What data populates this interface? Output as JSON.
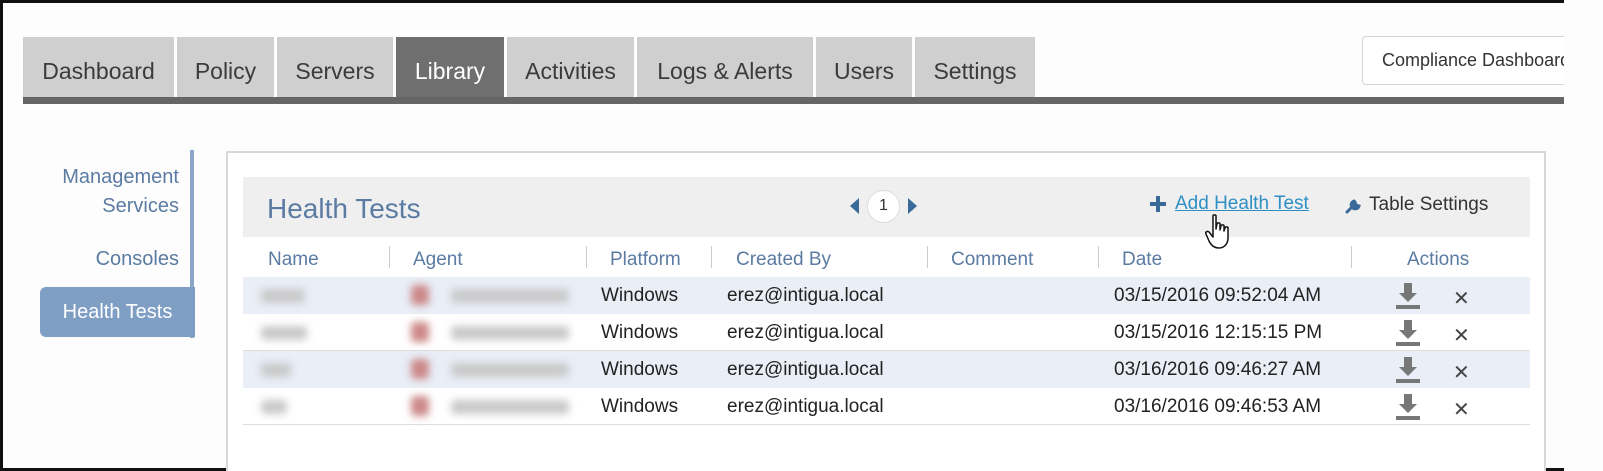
{
  "nav": {
    "tabs": [
      {
        "label": "Dashboard"
      },
      {
        "label": "Policy"
      },
      {
        "label": "Servers"
      },
      {
        "label": "Library"
      },
      {
        "label": "Activities"
      },
      {
        "label": "Logs & Alerts"
      },
      {
        "label": "Users"
      },
      {
        "label": "Settings"
      }
    ],
    "active_tab": "Library",
    "compliance_button": "Compliance Dashboard"
  },
  "sidebar": {
    "items": [
      {
        "label_line1": "Management",
        "label_line2": "Services"
      },
      {
        "label": "Consoles"
      },
      {
        "label": "Health Tests"
      }
    ],
    "active": "Health Tests"
  },
  "main": {
    "title": "Health Tests",
    "pager": {
      "current_page": "1"
    },
    "add_button": "Add Health Test",
    "settings_button": "Table Settings",
    "columns": [
      "Name",
      "Agent",
      "Platform",
      "Created By",
      "Comment",
      "Date",
      "Actions"
    ],
    "rows": [
      {
        "platform": "Windows",
        "created_by": "erez@intigua.local",
        "comment": "",
        "date": "03/15/2016 09:52:04 AM"
      },
      {
        "platform": "Windows",
        "created_by": "erez@intigua.local",
        "comment": "",
        "date": "03/15/2016 12:15:15 PM"
      },
      {
        "platform": "Windows",
        "created_by": "erez@intigua.local",
        "comment": "",
        "date": "03/16/2016 09:46:27 AM"
      },
      {
        "platform": "Windows",
        "created_by": "erez@intigua.local",
        "comment": "",
        "date": "03/16/2016 09:46:53 AM"
      }
    ]
  },
  "colors": {
    "accent": "#5b7ba3",
    "link": "#2f8fc4",
    "active_tab": "#6f6f6f",
    "row_alt": "#e9eef7"
  },
  "icons": [
    "plus-icon",
    "wrench-icon",
    "chevron-left-icon",
    "chevron-right-icon",
    "download-icon",
    "close-icon",
    "hand-cursor-icon"
  ]
}
